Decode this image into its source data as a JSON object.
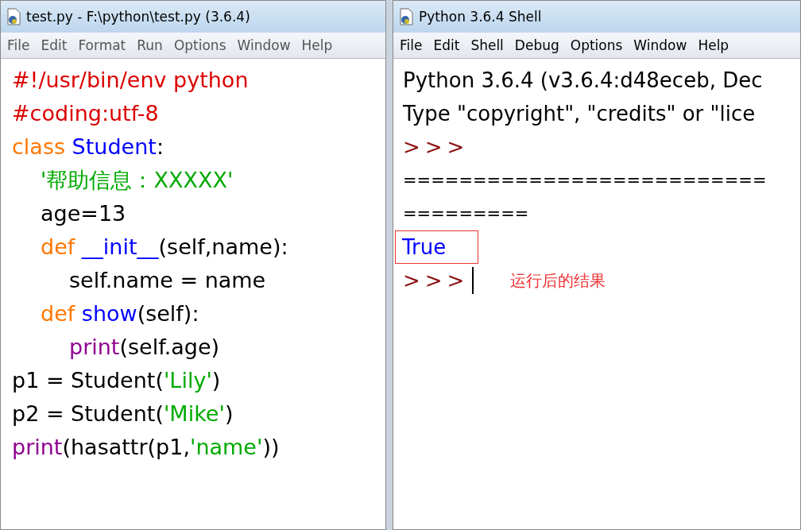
{
  "editor": {
    "title": "test.py - F:\\python\\test.py (3.6.4)",
    "menu": [
      "File",
      "Edit",
      "Format",
      "Run",
      "Options",
      "Window",
      "Help"
    ],
    "lines": [
      {
        "tokens": [
          {
            "text": "#!/usr/bin/env python",
            "kind": "comment"
          }
        ]
      },
      {
        "tokens": [
          {
            "text": "#coding:utf-8",
            "kind": "comment"
          }
        ]
      },
      {
        "tokens": [
          {
            "text": "class ",
            "kind": "keyword"
          },
          {
            "text": "Student",
            "kind": "definition"
          },
          {
            "text": ":",
            "kind": "plain"
          }
        ],
        "children": [
          {
            "tokens": [
              {
                "text": "'帮助信息：XXXXX'",
                "kind": "string"
              }
            ]
          },
          {
            "tokens": [
              {
                "text": "age=13",
                "kind": "plain"
              }
            ]
          },
          {
            "tokens": [
              {
                "text": "def ",
                "kind": "keyword"
              },
              {
                "text": "__init__",
                "kind": "definition"
              },
              {
                "text": "(self,name):",
                "kind": "plain"
              }
            ],
            "children": [
              {
                "tokens": [
                  {
                    "text": "self.name = name",
                    "kind": "plain"
                  }
                ]
              }
            ]
          },
          {
            "tokens": [
              {
                "text": "def ",
                "kind": "keyword"
              },
              {
                "text": "show",
                "kind": "definition"
              },
              {
                "text": "(self):",
                "kind": "plain"
              }
            ],
            "children": [
              {
                "tokens": [
                  {
                    "text": "print",
                    "kind": "builtin"
                  },
                  {
                    "text": "(self.age)",
                    "kind": "plain"
                  }
                ]
              }
            ]
          }
        ]
      },
      {
        "tokens": [
          {
            "text": "p1 = Student(",
            "kind": "plain"
          },
          {
            "text": "'Lily'",
            "kind": "string"
          },
          {
            "text": ")",
            "kind": "plain"
          }
        ]
      },
      {
        "tokens": [
          {
            "text": "p2 = Student(",
            "kind": "plain"
          },
          {
            "text": "'Mike'",
            "kind": "string"
          },
          {
            "text": ")",
            "kind": "plain"
          }
        ]
      },
      {
        "tokens": [
          {
            "text": "print",
            "kind": "builtin"
          },
          {
            "text": "(hasattr(p1,",
            "kind": "plain"
          },
          {
            "text": "'name'",
            "kind": "string"
          },
          {
            "text": "))",
            "kind": "plain"
          }
        ]
      }
    ]
  },
  "shell": {
    "title": "Python 3.6.4 Shell",
    "menu": [
      "File",
      "Edit",
      "Shell",
      "Debug",
      "Options",
      "Window",
      "Help"
    ],
    "lines": [
      {
        "text": "Python 3.6.4 (v3.6.4:d48eceb, Dec",
        "kind": "plain"
      },
      {
        "text": "Type \"copyright\", \"credits\" or \"lice",
        "kind": "plain"
      },
      {
        "text": ">>>",
        "kind": "prompt"
      },
      {
        "text": "==========================",
        "kind": "rule"
      },
      {
        "text": "=========",
        "kind": "rule"
      },
      {
        "text": "True",
        "kind": "output"
      },
      {
        "text": ">>>",
        "kind": "prompt"
      }
    ],
    "annotation": "运行后的结果"
  }
}
